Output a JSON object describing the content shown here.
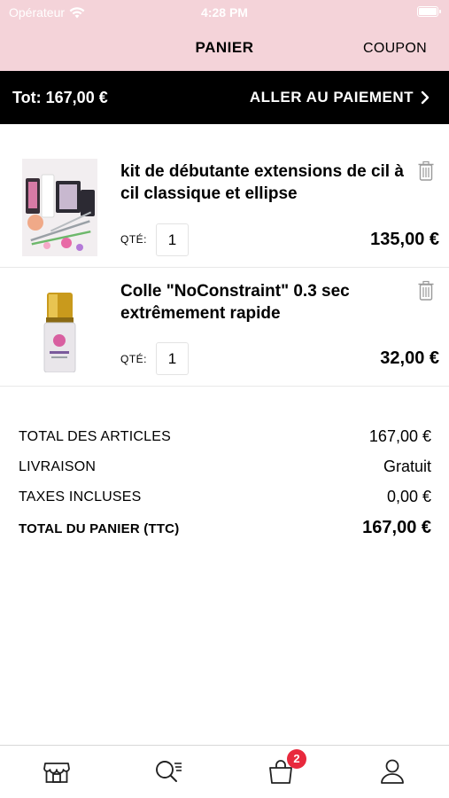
{
  "status_bar": {
    "carrier": "Opérateur",
    "time": "4:28 PM"
  },
  "nav": {
    "title": "PANIER",
    "coupon_label": "COUPON"
  },
  "total_bar": {
    "total_text": "Tot: 167,00 €",
    "checkout_label": "ALLER AU PAIEMENT"
  },
  "cart": {
    "quantity_label": "QTÉ:",
    "items": [
      {
        "name": "kit de débutante extensions de cil à cil classique et ellipse",
        "quantity": "1",
        "price": "135,00 €"
      },
      {
        "name": "Colle \"NoConstraint\" 0.3 sec extrêmement rapide",
        "quantity": "1",
        "price": "32,00 €"
      }
    ]
  },
  "summary": {
    "rows": [
      {
        "label": "TOTAL DES ARTICLES",
        "value": "167,00 €"
      },
      {
        "label": "LIVRAISON",
        "value": "Gratuit"
      },
      {
        "label": "TAXES INCLUSES",
        "value": "0,00 €"
      },
      {
        "label": "TOTAL DU PANIER (TTC)",
        "value": "167,00 €"
      }
    ]
  },
  "tab_bar": {
    "tabs": [
      {
        "icon": "store-icon"
      },
      {
        "icon": "search-list-icon"
      },
      {
        "icon": "bag-icon",
        "badge": "2"
      },
      {
        "icon": "user-icon"
      }
    ]
  },
  "colors": {
    "header_pink": "#f4d3d9",
    "total_bar": "#000000",
    "badge_red": "#e8293d"
  }
}
